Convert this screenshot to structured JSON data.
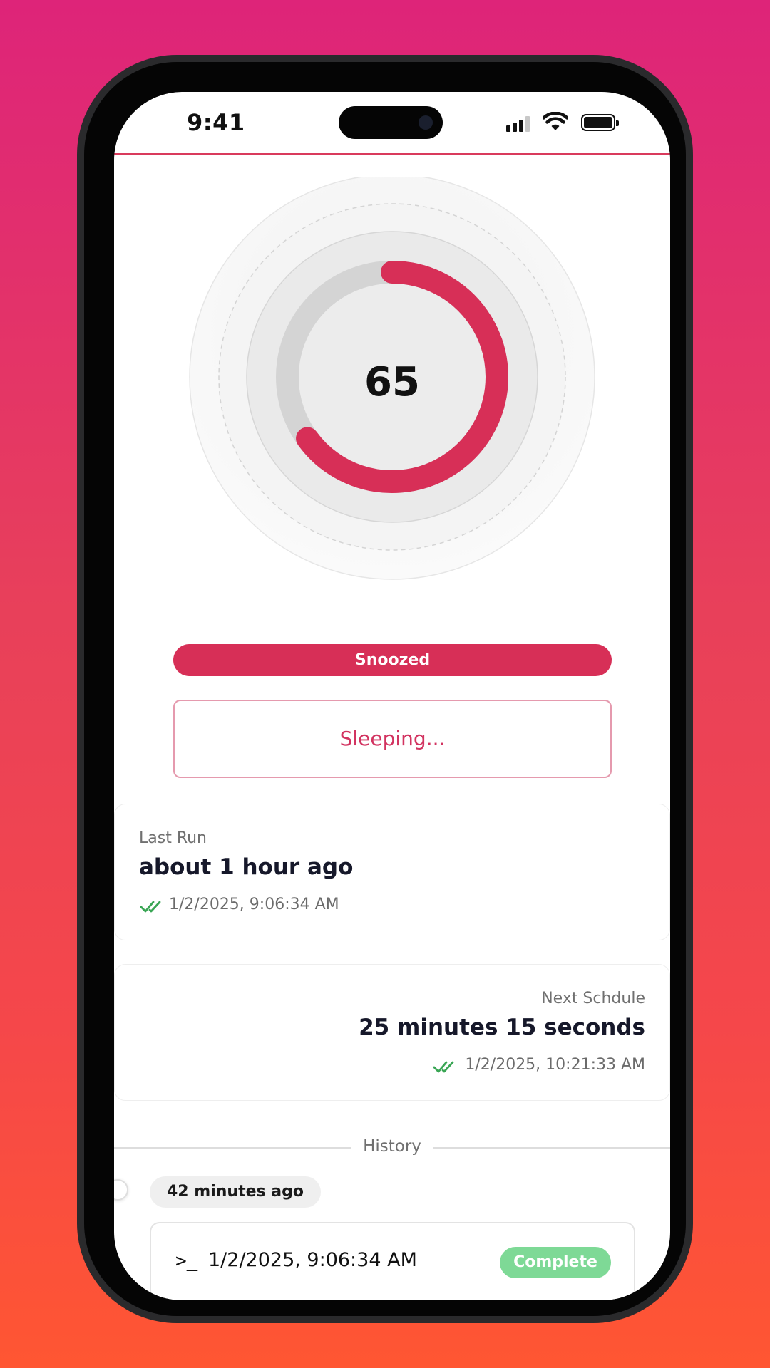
{
  "status_bar": {
    "time": "9:41"
  },
  "gauge": {
    "value": "65",
    "progress": 0.65,
    "accent": "#d72f57",
    "track": "#d4d4d4"
  },
  "status": {
    "pill_label": "Snoozed",
    "message": "Sleeping..."
  },
  "last_run": {
    "label": "Last Run",
    "relative": "about 1 hour ago",
    "timestamp": "1/2/2025, 9:06:34 AM",
    "icon": "double-check-icon"
  },
  "next_schedule": {
    "label": "Next Schdule",
    "relative": "25 minutes 15 seconds",
    "timestamp": "1/2/2025, 10:21:33 AM",
    "icon": "double-check-icon"
  },
  "history": {
    "title": "History",
    "entries": [
      {
        "relative": "42 minutes ago",
        "prompt": ">_",
        "timestamp": "1/2/2025, 9:06:34 AM",
        "status": "Complete",
        "status_color": "#7ed996"
      }
    ]
  }
}
